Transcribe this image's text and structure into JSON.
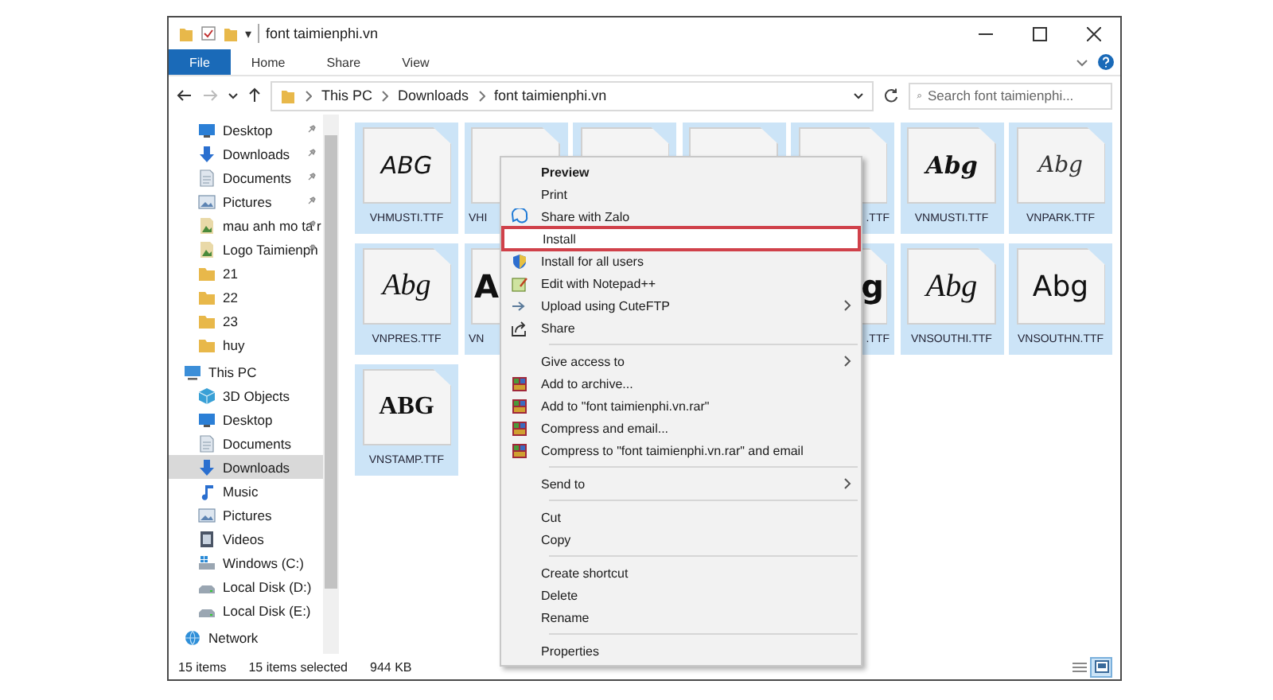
{
  "window": {
    "title": "font taimienphi.vn",
    "quick_access_arrow": "▾"
  },
  "ribbon": {
    "tabs": [
      {
        "label": "File",
        "selected": true
      },
      {
        "label": "Home",
        "selected": false
      },
      {
        "label": "Share",
        "selected": false
      },
      {
        "label": "View",
        "selected": false
      }
    ]
  },
  "address": {
    "path": [
      "This PC",
      "Downloads",
      "font taimienphi.vn"
    ],
    "search": {
      "placeholder": "Search font taimienphi..."
    }
  },
  "sidebar": {
    "sections": [
      {
        "items": [
          {
            "label": "Desktop",
            "kind": "desktop",
            "pinned": true,
            "selected": false
          },
          {
            "label": "Downloads",
            "kind": "download",
            "pinned": true,
            "selected": false
          },
          {
            "label": "Documents",
            "kind": "document",
            "pinned": true,
            "selected": false
          },
          {
            "label": "Pictures",
            "kind": "picture",
            "pinned": true,
            "selected": false
          },
          {
            "label": "mau anh mo ta r",
            "kind": "image",
            "pinned": true,
            "selected": false
          },
          {
            "label": "Logo Taimienph",
            "kind": "image",
            "pinned": true,
            "selected": false
          },
          {
            "label": "21",
            "kind": "folder",
            "pinned": false,
            "selected": false
          },
          {
            "label": "22",
            "kind": "folder",
            "pinned": false,
            "selected": false
          },
          {
            "label": "23",
            "kind": "folder",
            "pinned": false,
            "selected": false
          },
          {
            "label": "huy",
            "kind": "folder",
            "pinned": false,
            "selected": false
          }
        ]
      },
      {
        "header": {
          "label": "This PC",
          "kind": "pc"
        },
        "items": [
          {
            "label": "3D Objects",
            "kind": "objects",
            "pinned": false,
            "selected": false
          },
          {
            "label": "Desktop",
            "kind": "desktop",
            "pinned": false,
            "selected": false
          },
          {
            "label": "Documents",
            "kind": "document",
            "pinned": false,
            "selected": false
          },
          {
            "label": "Downloads",
            "kind": "download",
            "pinned": false,
            "selected": true
          },
          {
            "label": "Music",
            "kind": "music",
            "pinned": false,
            "selected": false
          },
          {
            "label": "Pictures",
            "kind": "picture",
            "pinned": false,
            "selected": false
          },
          {
            "label": "Videos",
            "kind": "video",
            "pinned": false,
            "selected": false
          },
          {
            "label": "Windows (C:)",
            "kind": "drive",
            "pinned": false,
            "selected": false
          },
          {
            "label": "Local Disk (D:)",
            "kind": "disk",
            "pinned": false,
            "selected": false
          },
          {
            "label": "Local Disk (E:)",
            "kind": "disk",
            "pinned": false,
            "selected": false
          }
        ]
      },
      {
        "header": {
          "label": "Network",
          "kind": "network"
        }
      }
    ]
  },
  "files": [
    {
      "kind": "full",
      "label": "VHMUSTI.TTF",
      "sample": "ABG",
      "selected": true
    },
    {
      "kind": "cut_right",
      "label": "VHI",
      "selected": true
    },
    {
      "kind": "covered",
      "selected": true
    },
    {
      "kind": "covered",
      "selected": true
    },
    {
      "kind": "cut_left",
      "label": ".TTF",
      "selected": true
    },
    {
      "kind": "full",
      "label": "VNMUSTI.TTF",
      "sample": "Abg",
      "selected": true
    },
    {
      "kind": "full",
      "label": "VNPARK.TTF",
      "sample": "Abg",
      "selected": true
    },
    {
      "kind": "full",
      "label": "VNPRES.TTF",
      "sample": "Abg",
      "selected": true
    },
    {
      "kind": "cut_right",
      "label": "VN",
      "sample": "A",
      "selected": true
    },
    {
      "kind": "cut_left",
      "label": ".TTF",
      "sample": "g",
      "selected": true
    },
    {
      "kind": "full",
      "label": "VNSOUTHI.TTF",
      "sample": "Abg",
      "selected": true
    },
    {
      "kind": "full",
      "label": "VNSOUTHN.TTF",
      "sample": "Abg",
      "selected": true
    },
    {
      "kind": "full",
      "label": "VNSTAMP.TTF",
      "sample": "ABG",
      "selected": true
    }
  ],
  "context_menu": {
    "groups": [
      [
        {
          "label": "Preview",
          "default": true,
          "kind": "plain",
          "submenu": false,
          "highlighted": false
        },
        {
          "label": "Print",
          "default": false,
          "kind": "plain",
          "submenu": false,
          "highlighted": false
        },
        {
          "label": "Share with Zalo",
          "default": false,
          "kind": "zalo",
          "submenu": false,
          "highlighted": false
        },
        {
          "label": "Install",
          "default": false,
          "kind": "plain",
          "submenu": false,
          "highlighted": true
        },
        {
          "label": "Install for all users",
          "default": false,
          "kind": "shield",
          "submenu": false,
          "highlighted": false
        },
        {
          "label": "Edit with Notepad++",
          "default": false,
          "kind": "notepad",
          "submenu": false,
          "highlighted": false
        },
        {
          "label": "Upload using CuteFTP",
          "default": false,
          "kind": "ftp",
          "submenu": true,
          "highlighted": false
        },
        {
          "label": "Share",
          "default": false,
          "kind": "share",
          "submenu": false,
          "highlighted": false
        }
      ],
      [
        {
          "label": "Give access to",
          "default": false,
          "kind": "plain",
          "submenu": true,
          "highlighted": false
        },
        {
          "label": "Add to archive...",
          "default": false,
          "kind": "archive",
          "submenu": false,
          "highlighted": false
        },
        {
          "label": "Add to \"font taimienphi.vn.rar\"",
          "default": false,
          "kind": "archive",
          "submenu": false,
          "highlighted": false
        },
        {
          "label": "Compress and email...",
          "default": false,
          "kind": "archive",
          "submenu": false,
          "highlighted": false
        },
        {
          "label": "Compress to \"font taimienphi.vn.rar\" and email",
          "default": false,
          "kind": "archive",
          "submenu": false,
          "highlighted": false
        }
      ],
      [
        {
          "label": "Send to",
          "default": false,
          "kind": "plain",
          "submenu": true,
          "highlighted": false
        }
      ],
      [
        {
          "label": "Cut",
          "default": false,
          "kind": "plain",
          "submenu": false,
          "highlighted": false
        },
        {
          "label": "Copy",
          "default": false,
          "kind": "plain",
          "submenu": false,
          "highlighted": false
        }
      ],
      [
        {
          "label": "Create shortcut",
          "default": false,
          "kind": "plain",
          "submenu": false,
          "highlighted": false
        },
        {
          "label": "Delete",
          "default": false,
          "kind": "plain",
          "submenu": false,
          "highlighted": false
        },
        {
          "label": "Rename",
          "default": false,
          "kind": "plain",
          "submenu": false,
          "highlighted": false
        }
      ],
      [
        {
          "label": "Properties",
          "default": false,
          "kind": "plain",
          "submenu": false,
          "highlighted": false
        }
      ]
    ]
  },
  "status_bar": {
    "count": "15 items",
    "selection": "15 items selected",
    "size": "944 KB",
    "views": [
      {
        "kind": "details",
        "selected": false
      },
      {
        "kind": "large_icons",
        "selected": true
      }
    ]
  }
}
